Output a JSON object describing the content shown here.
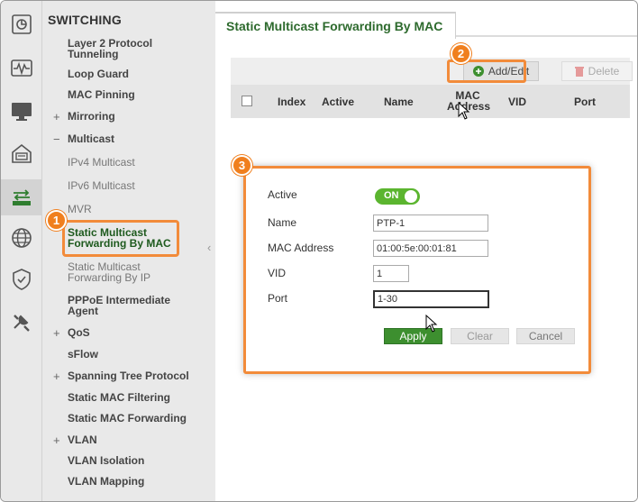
{
  "rail": {
    "icons": [
      "dashboard-icon",
      "monitor-waveform-icon",
      "display-icon",
      "maintenance-icon",
      "switching-icon",
      "globe-icon",
      "security-shield-icon",
      "tools-icon"
    ],
    "active": "switching-icon"
  },
  "sidenav": {
    "heading": "SWITCHING",
    "items": [
      {
        "label": "Layer 2 Protocol Tunneling",
        "sign": ""
      },
      {
        "label": "Loop Guard",
        "sign": ""
      },
      {
        "label": "MAC Pinning",
        "sign": ""
      },
      {
        "label": "Mirroring",
        "sign": "+"
      },
      {
        "label": "Multicast",
        "sign": "−"
      },
      {
        "label": "IPv4 Multicast",
        "sign": ""
      },
      {
        "label": "IPv6 Multicast",
        "sign": ""
      },
      {
        "label": "MVR",
        "sign": ""
      },
      {
        "label": "Static Multicast Forwarding By MAC",
        "sign": ""
      },
      {
        "label": "Static Multicast Forwarding By IP",
        "sign": ""
      },
      {
        "label": "PPPoE Intermediate Agent",
        "sign": ""
      },
      {
        "label": "QoS",
        "sign": "+"
      },
      {
        "label": "sFlow",
        "sign": ""
      },
      {
        "label": "Spanning Tree Protocol",
        "sign": "+"
      },
      {
        "label": "Static MAC Filtering",
        "sign": ""
      },
      {
        "label": "Static MAC Forwarding",
        "sign": ""
      },
      {
        "label": "VLAN",
        "sign": "+"
      },
      {
        "label": "VLAN Isolation",
        "sign": ""
      },
      {
        "label": "VLAN Mapping",
        "sign": ""
      }
    ],
    "selected": "Static Multicast Forwarding By MAC"
  },
  "main": {
    "title": "Static Multicast Forwarding By MAC",
    "toolbar": {
      "add_label": "Add/Edit",
      "delete_label": "Delete"
    },
    "table": {
      "headers": [
        "Index",
        "Active",
        "Name",
        "MAC Address",
        "VID",
        "Port"
      ]
    }
  },
  "callouts": [
    "1",
    "2",
    "3"
  ],
  "dialog": {
    "active_label": "Active",
    "active_value": "ON",
    "name_label": "Name",
    "name_value": "PTP-1",
    "mac_label": "MAC Address",
    "mac_value": "01:00:5e:00:01:81",
    "vid_label": "VID",
    "vid_value": "1",
    "port_label": "Port",
    "port_value": "1-30",
    "apply_label": "Apply",
    "clear_label": "Clear",
    "cancel_label": "Cancel"
  },
  "colors": {
    "accent_green": "#2d6a2d",
    "callout_orange": "#f07f1e",
    "toggle_on": "#5bb52f",
    "apply_green": "#3d8f2f"
  }
}
